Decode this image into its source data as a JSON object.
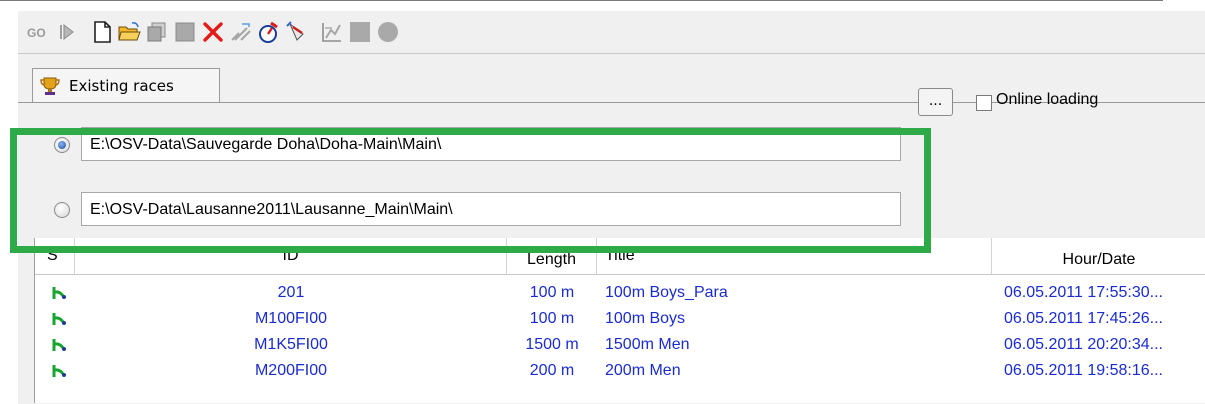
{
  "toolbar": {
    "buttons": [
      {
        "name": "go-icon",
        "label": "GO"
      },
      {
        "name": "play-icon"
      },
      {
        "name": "new-document-icon"
      },
      {
        "name": "open-folder-icon"
      },
      {
        "name": "copy-icon"
      },
      {
        "name": "stop-square-icon"
      },
      {
        "name": "delete-icon"
      },
      {
        "name": "edit-icon"
      },
      {
        "name": "timer-icon"
      },
      {
        "name": "flag-icon"
      },
      {
        "name": "chart-icon"
      },
      {
        "name": "square-icon"
      },
      {
        "name": "circle-icon"
      }
    ]
  },
  "tab": {
    "label": "Existing races"
  },
  "sources": [
    {
      "path": "E:\\OSV-Data\\Sauvegarde Doha\\Doha-Main\\Main\\",
      "selected": true
    },
    {
      "path": "E:\\OSV-Data\\Lausanne2011\\Lausanne_Main\\Main\\",
      "selected": false
    }
  ],
  "browse_label": "...",
  "online_loading_label": "Online loading",
  "online_loading_checked": false,
  "table": {
    "headers": {
      "s": "S",
      "id": "ID",
      "length": "Length",
      "title": "Title",
      "hour": "Hour/Date"
    },
    "rows": [
      {
        "id": "201",
        "length": "100 m",
        "title": "100m Boys_Para",
        "hour": "06.05.2011 17:55:30..."
      },
      {
        "id": "M100FI00",
        "length": "100 m",
        "title": "100m Boys",
        "hour": "06.05.2011 17:45:26..."
      },
      {
        "id": "M1K5FI00",
        "length": "1500 m",
        "title": "1500m Men",
        "hour": "06.05.2011 20:20:34..."
      },
      {
        "id": "M200FI00",
        "length": "200 m",
        "title": "200m Men",
        "hour": "06.05.2011 19:58:16..."
      }
    ]
  },
  "colors": {
    "highlight": "#2eaa49",
    "link_text": "#1a2bd0",
    "status_green": "#17a52f"
  }
}
